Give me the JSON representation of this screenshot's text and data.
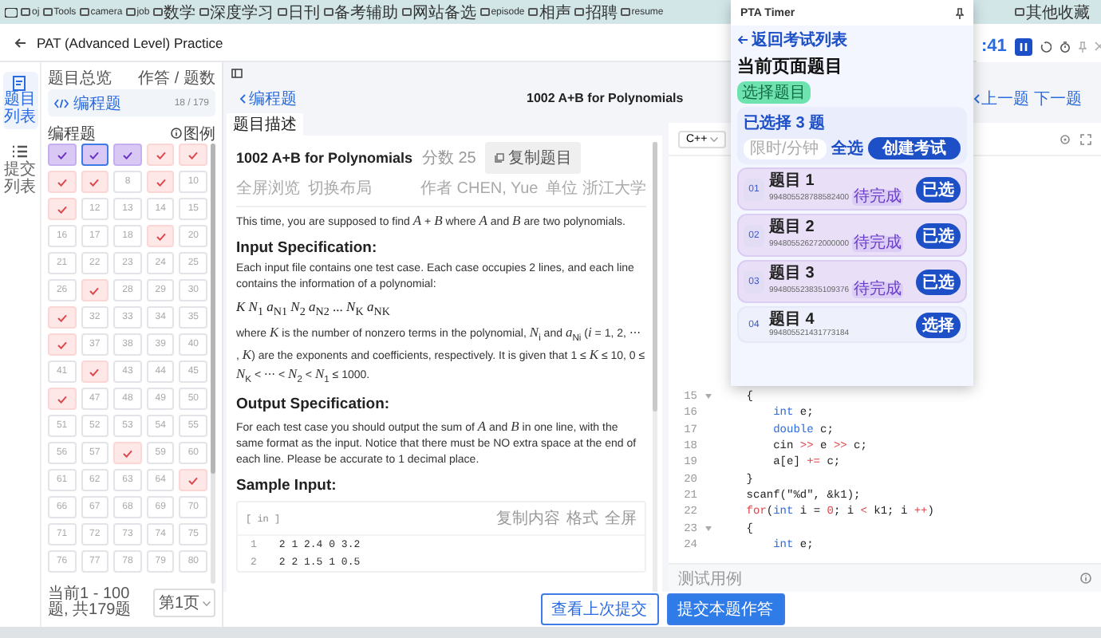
{
  "bookmarks": {
    "items": [
      {
        "label": "oj"
      },
      {
        "label": "Tools"
      },
      {
        "label": "camera"
      },
      {
        "label": "job"
      },
      {
        "label": "数学"
      },
      {
        "label": "深度学习"
      },
      {
        "label": "日刊"
      },
      {
        "label": "备考辅助"
      },
      {
        "label": "网站备选"
      },
      {
        "label": "episode"
      },
      {
        "label": "相声"
      },
      {
        "label": "招聘"
      },
      {
        "label": "resume"
      }
    ],
    "other": "其他收藏"
  },
  "header": {
    "title": "PAT (Advanced Level) Practice"
  },
  "rail": [
    {
      "label": "题目列表",
      "selected": true
    },
    {
      "label": "提交列表",
      "selected": false
    }
  ],
  "sidebar": {
    "overview_label": "题目总览",
    "count_label": "作答 / 题数",
    "category": {
      "label": "编程题",
      "count": "18 / 179"
    },
    "grid_title": "编程题",
    "legend": "图例",
    "footer": "当前1 - 100题, 共179题",
    "page": "第1页",
    "cells": [
      {
        "kind": "marked",
        "current": false
      },
      {
        "kind": "marked",
        "current": true
      },
      {
        "kind": "marked",
        "current": false
      },
      {
        "kind": "accepted",
        "current": false
      },
      {
        "kind": "accepted",
        "current": false
      },
      {
        "kind": "accepted",
        "current": false
      },
      {
        "kind": "accepted",
        "current": false
      },
      {
        "kind": "open",
        "label": "8",
        "current": false
      },
      {
        "kind": "accepted",
        "current": false
      },
      {
        "kind": "open",
        "label": "10",
        "current": false
      },
      {
        "kind": "accepted",
        "current": false
      },
      {
        "kind": "open",
        "label": "12",
        "current": false
      },
      {
        "kind": "open",
        "label": "13",
        "current": false
      },
      {
        "kind": "open",
        "label": "14",
        "current": false
      },
      {
        "kind": "open",
        "label": "15",
        "current": false
      },
      {
        "kind": "open",
        "label": "16",
        "current": false
      },
      {
        "kind": "open",
        "label": "17",
        "current": false
      },
      {
        "kind": "open",
        "label": "18",
        "current": false
      },
      {
        "kind": "accepted",
        "current": false
      },
      {
        "kind": "open",
        "label": "20",
        "current": false
      },
      {
        "kind": "open",
        "label": "21",
        "current": false
      },
      {
        "kind": "open",
        "label": "22",
        "current": false
      },
      {
        "kind": "open",
        "label": "23",
        "current": false
      },
      {
        "kind": "open",
        "label": "24",
        "current": false
      },
      {
        "kind": "open",
        "label": "25",
        "current": false
      },
      {
        "kind": "open",
        "label": "26",
        "current": false
      },
      {
        "kind": "accepted",
        "current": false
      },
      {
        "kind": "open",
        "label": "28",
        "current": false
      },
      {
        "kind": "open",
        "label": "29",
        "current": false
      },
      {
        "kind": "open",
        "label": "30",
        "current": false
      },
      {
        "kind": "accepted",
        "current": false
      },
      {
        "kind": "open",
        "label": "32",
        "current": false
      },
      {
        "kind": "open",
        "label": "33",
        "current": false
      },
      {
        "kind": "open",
        "label": "34",
        "current": false
      },
      {
        "kind": "open",
        "label": "35",
        "current": false
      },
      {
        "kind": "accepted",
        "current": false
      },
      {
        "kind": "open",
        "label": "37",
        "current": false
      },
      {
        "kind": "open",
        "label": "38",
        "current": false
      },
      {
        "kind": "open",
        "label": "39",
        "current": false
      },
      {
        "kind": "open",
        "label": "40",
        "current": false
      },
      {
        "kind": "open",
        "label": "41",
        "current": false
      },
      {
        "kind": "accepted",
        "current": false
      },
      {
        "kind": "open",
        "label": "43",
        "current": false
      },
      {
        "kind": "open",
        "label": "44",
        "current": false
      },
      {
        "kind": "open",
        "label": "45",
        "current": false
      },
      {
        "kind": "accepted",
        "current": false
      },
      {
        "kind": "open",
        "label": "47",
        "current": false
      },
      {
        "kind": "open",
        "label": "48",
        "current": false
      },
      {
        "kind": "open",
        "label": "49",
        "current": false
      },
      {
        "kind": "open",
        "label": "50",
        "current": false
      },
      {
        "kind": "open",
        "label": "51",
        "current": false
      },
      {
        "kind": "open",
        "label": "52",
        "current": false
      },
      {
        "kind": "open",
        "label": "53",
        "current": false
      },
      {
        "kind": "open",
        "label": "54",
        "current": false
      },
      {
        "kind": "open",
        "label": "55",
        "current": false
      },
      {
        "kind": "open",
        "label": "56",
        "current": false
      },
      {
        "kind": "open",
        "label": "57",
        "current": false
      },
      {
        "kind": "accepted",
        "current": false
      },
      {
        "kind": "open",
        "label": "59",
        "current": false
      },
      {
        "kind": "open",
        "label": "60",
        "current": false
      },
      {
        "kind": "open",
        "label": "61",
        "current": false
      },
      {
        "kind": "open",
        "label": "62",
        "current": false
      },
      {
        "kind": "open",
        "label": "63",
        "current": false
      },
      {
        "kind": "open",
        "label": "64",
        "current": false
      },
      {
        "kind": "accepted",
        "current": false
      },
      {
        "kind": "open",
        "label": "66",
        "current": false
      },
      {
        "kind": "open",
        "label": "67",
        "current": false
      },
      {
        "kind": "open",
        "label": "68",
        "current": false
      },
      {
        "kind": "open",
        "label": "69",
        "current": false
      },
      {
        "kind": "open",
        "label": "70",
        "current": false
      },
      {
        "kind": "open",
        "label": "71",
        "current": false
      },
      {
        "kind": "open",
        "label": "72",
        "current": false
      },
      {
        "kind": "open",
        "label": "73",
        "current": false
      },
      {
        "kind": "open",
        "label": "74",
        "current": false
      },
      {
        "kind": "open",
        "label": "75",
        "current": false
      },
      {
        "kind": "open",
        "label": "76",
        "current": false
      },
      {
        "kind": "open",
        "label": "77",
        "current": false
      },
      {
        "kind": "open",
        "label": "78",
        "current": false
      },
      {
        "kind": "open",
        "label": "79",
        "current": false
      },
      {
        "kind": "open",
        "label": "80",
        "current": false
      }
    ]
  },
  "nav": {
    "back": "编程题",
    "title": "1002 A+B for Polynomials",
    "prev": "上一题",
    "next": "下一题"
  },
  "tabs": [
    {
      "label": "题目描述",
      "selected": true
    }
  ],
  "problem": {
    "title": "1002 A+B for Polynomials",
    "score": "分数 25",
    "copy": "复制题目",
    "actions": [
      "全屏浏览",
      "切换布局"
    ],
    "author": "作者 CHEN, Yue",
    "unit": "单位 浙江大学",
    "blocks": [
      {
        "kind": "para",
        "text": "This time, you are supposed to find *A* + *B* where *A* and *B* are two polynomials."
      },
      {
        "kind": "heading",
        "text": "Input Specification:"
      },
      {
        "kind": "para",
        "text": "Each input file contains one test case. Each case occupies 2 lines, and each line contains the information of a polynomial:"
      },
      {
        "kind": "formula",
        "text": "*K N*$_{1}$ *a*$_{N1}$ *N*$_{2}$ *a*$_{N2}$ ... *N*$_{K}$ *a*$_{NK}$"
      },
      {
        "kind": "para",
        "text": "where *K* is the number of nonzero terms in the polynomial, *N*$_{i}$ and *a*$_{Ni}$ (*i* = 1, 2, ⋯ , *K*) are the exponents and coefficients, respectively. It is given that 1 ≤ *K* ≤ 10, 0 ≤ *N*$_{K}$ < ⋯ < *N*$_{2}$ < *N*$_{1}$ ≤ 1000."
      },
      {
        "kind": "heading",
        "text": "Output Specification:"
      },
      {
        "kind": "para",
        "text": "For each test case you should output the sum of *A* and *B* in one line, with the same format as the input. Notice that there must be NO extra space at the end of each line. Please be accurate to 1 decimal place."
      },
      {
        "kind": "heading",
        "text": "Sample Input:"
      },
      {
        "kind": "sample",
        "label": "[ in ]",
        "actions": [
          "复制内容",
          "格式",
          "全屏"
        ],
        "lines": [
          {
            "number": "1",
            "text": "2 1 2.4 0 3.2"
          },
          {
            "number": "2",
            "text": "2 2 1.5 1 0.5"
          }
        ]
      }
    ]
  },
  "editor": {
    "language": "C++",
    "testcase": "测试用例",
    "lines": [
      {
        "number": "15",
        "fold": true,
        "tokens": [
          {
            "text": "    {",
            "kind": "plain"
          }
        ]
      },
      {
        "number": "16",
        "fold": false,
        "tokens": [
          {
            "text": "        int",
            "kind": "keyword"
          },
          {
            "text": " e;",
            "kind": "plain"
          }
        ]
      },
      {
        "number": "17",
        "fold": false,
        "tokens": [
          {
            "text": "        double",
            "kind": "keyword"
          },
          {
            "text": " c;",
            "kind": "plain"
          }
        ]
      },
      {
        "number": "18",
        "fold": false,
        "tokens": [
          {
            "text": "        cin ",
            "kind": "plain"
          },
          {
            "text": ">>",
            "kind": "operator"
          },
          {
            "text": " e ",
            "kind": "plain"
          },
          {
            "text": ">>",
            "kind": "operator"
          },
          {
            "text": " c;",
            "kind": "plain"
          }
        ]
      },
      {
        "number": "19",
        "fold": false,
        "tokens": [
          {
            "text": "        a[e] ",
            "kind": "plain"
          },
          {
            "text": "+=",
            "kind": "operator"
          },
          {
            "text": " c;",
            "kind": "plain"
          }
        ]
      },
      {
        "number": "20",
        "fold": false,
        "tokens": [
          {
            "text": "    }",
            "kind": "plain"
          }
        ]
      },
      {
        "number": "21",
        "fold": false,
        "tokens": [
          {
            "text": "    scanf(\"%d\", &k1);",
            "kind": "plain"
          }
        ]
      },
      {
        "number": "22",
        "fold": false,
        "tokens": [
          {
            "text": "    for",
            "kind": "operator"
          },
          {
            "text": "(",
            "kind": "plain"
          },
          {
            "text": "int",
            "kind": "keyword"
          },
          {
            "text": " i = ",
            "kind": "plain"
          },
          {
            "text": "0",
            "kind": "operator"
          },
          {
            "text": "; i ",
            "kind": "plain"
          },
          {
            "text": "<",
            "kind": "operator"
          },
          {
            "text": " k1; i ",
            "kind": "plain"
          },
          {
            "text": "++",
            "kind": "operator"
          },
          {
            "text": ")",
            "kind": "plain"
          }
        ]
      },
      {
        "number": "23",
        "fold": true,
        "tokens": [
          {
            "text": "    {",
            "kind": "plain"
          }
        ]
      },
      {
        "number": "24",
        "fold": false,
        "tokens": [
          {
            "text": "        int",
            "kind": "keyword"
          },
          {
            "text": " e;",
            "kind": "plain"
          }
        ]
      }
    ]
  },
  "footer_buttons": [
    {
      "label": "查看上次提交",
      "kind": "outline"
    },
    {
      "label": "提交本题作答",
      "kind": "primary"
    }
  ],
  "timer": {
    "time": ":41",
    "running": true
  },
  "popup": {
    "title": "PTA Timer",
    "back": "返回考试列表",
    "heading": "当前页面题目",
    "tag": "选择题目",
    "selected_count": "已选择 3 题",
    "limit_placeholder": "限时/分钟",
    "select_all": "全选",
    "create": "创建考试",
    "items": [
      {
        "index": "01",
        "title": "题目 1",
        "id": "994805528788582400",
        "status": "待完成",
        "selected": true,
        "action": "已选"
      },
      {
        "index": "02",
        "title": "题目 2",
        "id": "994805526272000000",
        "status": "待完成",
        "selected": true,
        "action": "已选"
      },
      {
        "index": "03",
        "title": "题目 3",
        "id": "994805523835109376",
        "status": "待完成",
        "selected": true,
        "action": "已选"
      },
      {
        "index": "04",
        "title": "题目 4",
        "id": "994805521431773184",
        "selected": false,
        "action": "选择"
      }
    ]
  }
}
